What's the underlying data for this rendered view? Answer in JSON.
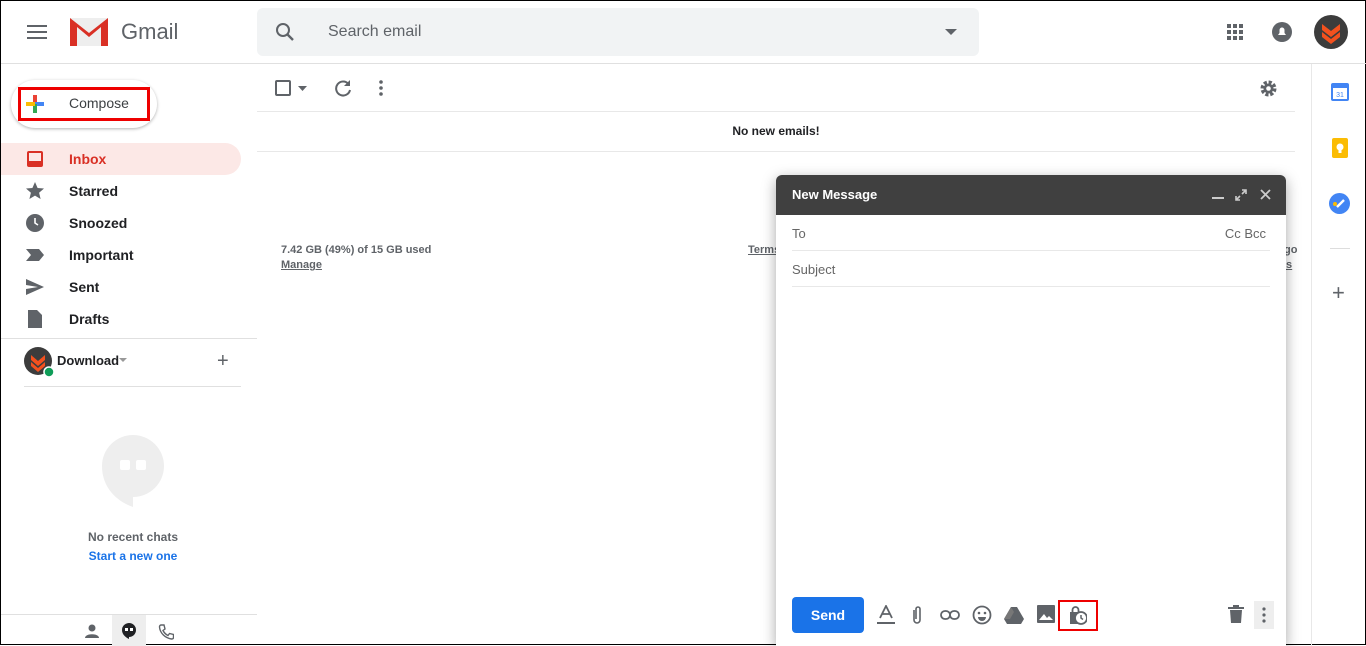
{
  "app": {
    "name": "Gmail"
  },
  "search": {
    "placeholder": "Search email"
  },
  "compose_button": {
    "label": "Compose"
  },
  "sidebar": {
    "items": [
      {
        "label": "Inbox",
        "icon": "inbox-icon",
        "active": true
      },
      {
        "label": "Starred",
        "icon": "star-icon"
      },
      {
        "label": "Snoozed",
        "icon": "clock-icon"
      },
      {
        "label": "Important",
        "icon": "important-icon"
      },
      {
        "label": "Sent",
        "icon": "send-icon"
      },
      {
        "label": "Drafts",
        "icon": "draft-icon"
      }
    ],
    "account": {
      "name": "Download"
    },
    "chats": {
      "empty": "No recent chats",
      "start": "Start a new one"
    }
  },
  "main": {
    "empty_message": "No new emails!",
    "storage": "7.42 GB (49%) of 15 GB used",
    "manage": "Manage",
    "terms": "Terms",
    "right_fragment_1": "go",
    "right_fragment_2": "ls"
  },
  "compose": {
    "title": "New Message",
    "to": "To",
    "cc_bcc": "Cc Bcc",
    "subject": "Subject",
    "send": "Send"
  },
  "colors": {
    "accent": "#1a73e8",
    "active_red": "#d93025",
    "active_bg": "#fce8e6",
    "compose_header": "#404040",
    "highlight": "#ee0000"
  }
}
